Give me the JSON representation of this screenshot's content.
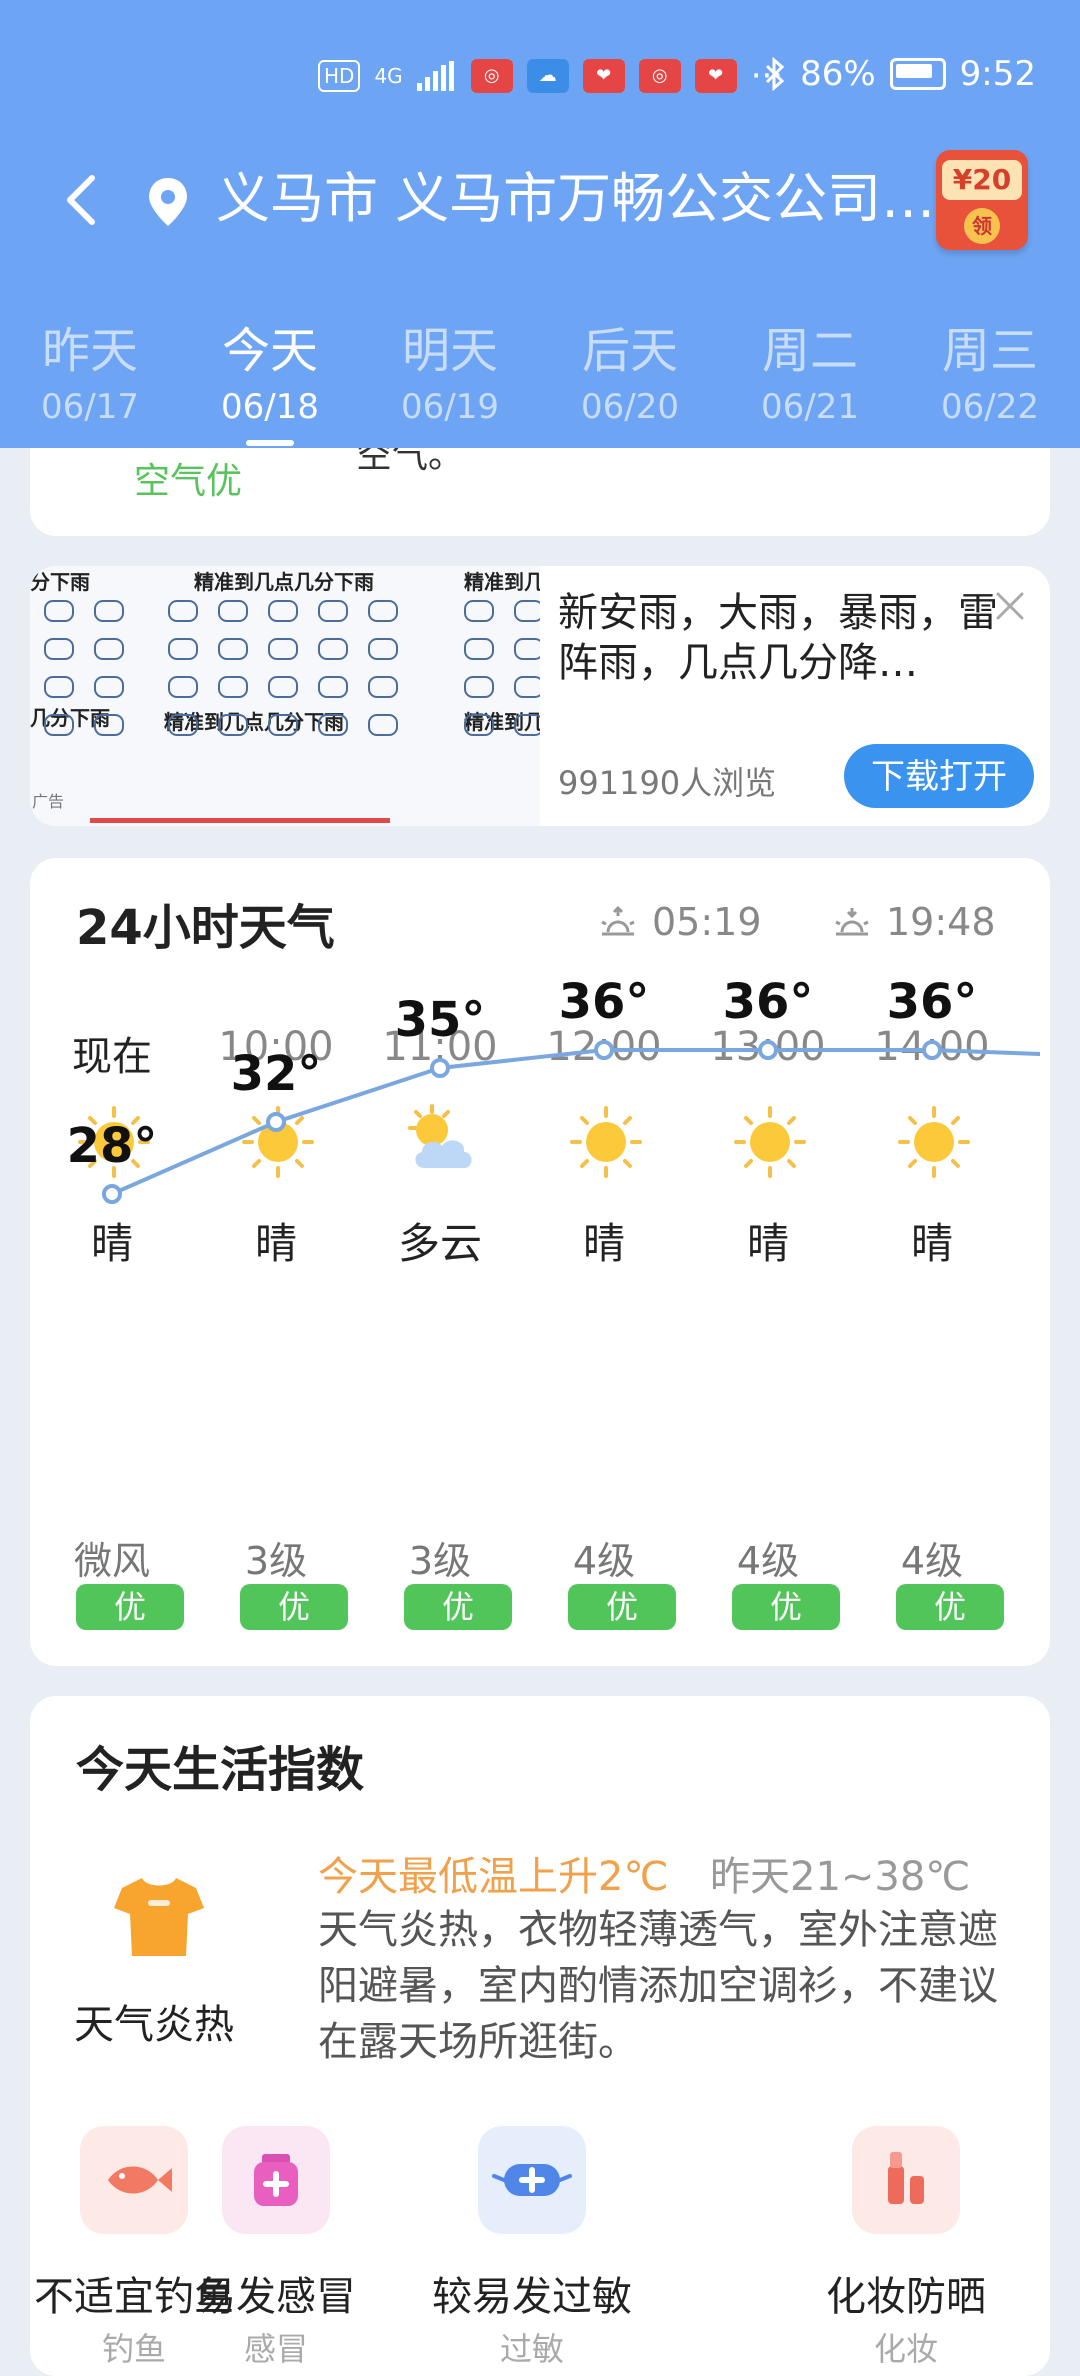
{
  "statusbar": {
    "hd": "HD",
    "net": "4G",
    "battery": "86%",
    "time": "9:52",
    "more": "···"
  },
  "header": {
    "location": "义马市 义马市万畅公交公司…",
    "redpacket_amount": "¥20",
    "redpacket_label": "领"
  },
  "days": [
    {
      "name": "昨天",
      "date": "06/17"
    },
    {
      "name": "今天",
      "date": "06/18",
      "active": true
    },
    {
      "name": "明天",
      "date": "06/19"
    },
    {
      "name": "后天",
      "date": "06/20"
    },
    {
      "name": "周二",
      "date": "06/21"
    },
    {
      "name": "周三",
      "date": "06/22"
    }
  ],
  "air": {
    "label": "空气优",
    "fragment": "空气。"
  },
  "ad": {
    "captions": [
      "分下雨",
      "精准到几点几分下雨",
      "精准到几",
      "几分下雨",
      "精准到几点几分下雨",
      "精准到几"
    ],
    "text": "新安雨，大雨，暴雨，雷阵雨，几点几分降…",
    "views": "991190人浏览",
    "button": "下载打开",
    "mark": "广告"
  },
  "hourly": {
    "title": "24小时天气",
    "sunrise": "05:19",
    "sunset": "19:48",
    "hours": [
      {
        "time": "现在",
        "cond": "晴",
        "icon": "sun-icon",
        "temp": "28°",
        "wind": "微风",
        "aqi": "优"
      },
      {
        "time": "10:00",
        "cond": "晴",
        "icon": "sun-icon",
        "temp": "32°",
        "wind": "3级",
        "aqi": "优"
      },
      {
        "time": "11:00",
        "cond": "多云",
        "icon": "partly-cloudy-icon",
        "temp": "35°",
        "wind": "3级",
        "aqi": "优"
      },
      {
        "time": "12:00",
        "cond": "晴",
        "icon": "sun-icon",
        "temp": "36°",
        "wind": "4级",
        "aqi": "优"
      },
      {
        "time": "13:00",
        "cond": "晴",
        "icon": "sun-icon",
        "temp": "36°",
        "wind": "4级",
        "aqi": "优"
      },
      {
        "time": "14:00",
        "cond": "晴",
        "icon": "sun-icon",
        "temp": "36°",
        "wind": "4级",
        "aqi": "优"
      }
    ]
  },
  "chart_data": {
    "type": "line",
    "x": [
      "现在",
      "10:00",
      "11:00",
      "12:00",
      "13:00",
      "14:00"
    ],
    "series": [
      {
        "values": [
          28,
          32,
          35,
          36,
          36,
          36
        ]
      }
    ],
    "ylabel": "",
    "xlabel": "",
    "title": ""
  },
  "life": {
    "title": "今天生活指数",
    "clothing_label": "天气炎热",
    "highlight": "今天最低温上升2℃",
    "yesterday": "昨天21~38℃",
    "desc": "天气炎热，衣物轻薄透气，室外注意遮阳避暑，室内酌情添加空调衫，不建议在露天场所逛街。",
    "items": [
      {
        "label": "不适宜钓鱼",
        "sub": "钓鱼",
        "icon": "fish-icon",
        "bg": "#fde9e6"
      },
      {
        "label": "易发感冒",
        "sub": "感冒",
        "icon": "medicine-icon",
        "bg": "#fbe6f4"
      },
      {
        "label": "较易发过敏",
        "sub": "过敏",
        "icon": "mask-icon",
        "bg": "#e6eefc"
      },
      {
        "label": "化妆防晒",
        "sub": "化妆",
        "icon": "cosmetics-icon",
        "bg": "#fde9e6"
      }
    ]
  },
  "colors": {
    "header": "#6ea4f4",
    "accent": "#3b93f0",
    "good": "#52c55a",
    "warn": "#f0a14a"
  }
}
